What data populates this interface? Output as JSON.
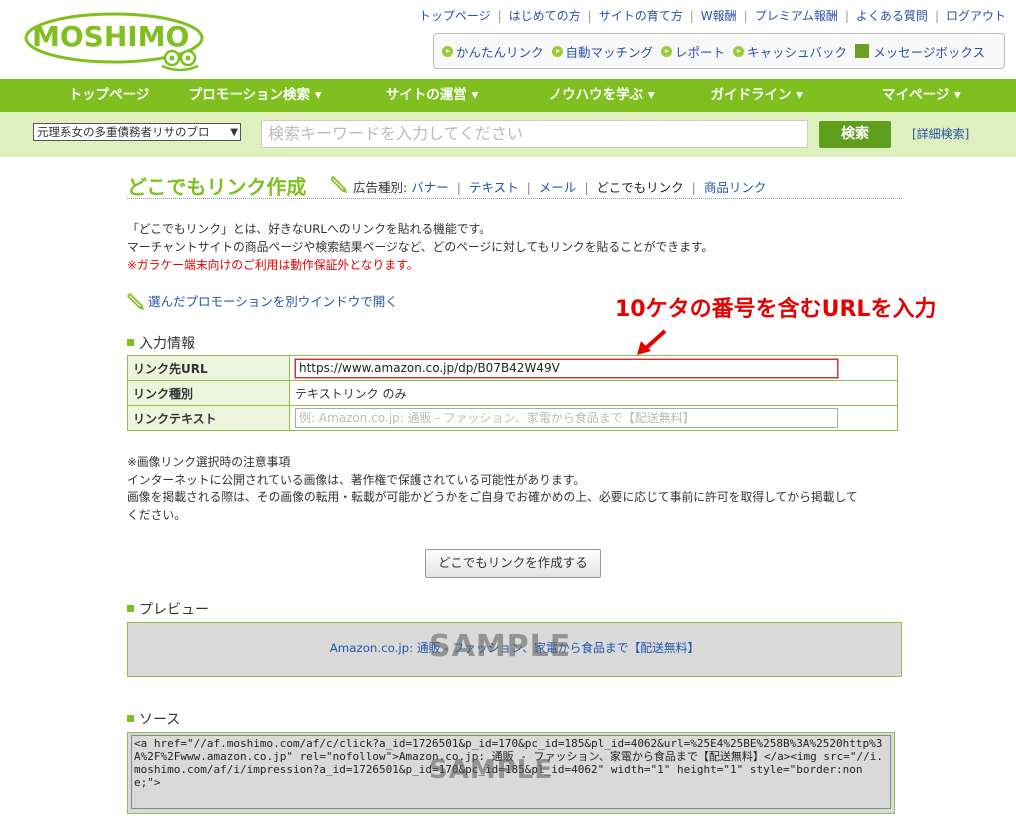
{
  "header": {
    "logo_text": "MOSHIMO",
    "top_links": [
      "トップページ",
      "はじめての方",
      "サイトの育て方",
      "W報酬",
      "プレミアム報酬",
      "よくある質問",
      "ログアウト"
    ],
    "tools": [
      "かんたんリンク",
      "自動マッチング",
      "レポート",
      "キャッシュバック",
      "メッセージボックス"
    ]
  },
  "nav": {
    "items": [
      "トップページ",
      "プロモーション検索 ▾",
      "サイトの運営 ▾",
      "ノウハウを学ぶ ▾",
      "ガイドライン ▾",
      "マイページ ▾"
    ]
  },
  "search": {
    "select_value": "元理系女の多重債務者リサのブロ",
    "placeholder": "検索キーワードを入力してください",
    "button": "検索",
    "advanced": "[詳細検索]"
  },
  "page": {
    "title": "どこでもリンク作成",
    "ad_type_label": "広告種別:",
    "ad_types": [
      "バナー",
      "テキスト",
      "メール",
      "どこでもリンク",
      "商品リンク"
    ],
    "intro": [
      "「どこでもリンク」とは、好きなURLへのリンクを貼れる機能です。",
      "マーチャントサイトの商品ページや検索結果ページなど、どのページに対してもリンクを貼ることができます。"
    ],
    "intro_warning": "※ガラケー端末向けのご利用は動作保証外となります。",
    "open_link": "選んだプロモーションを別ウインドウで開く",
    "annotation": "10ケタの番号を含むURLを入力"
  },
  "input_section": {
    "heading": "入力情報",
    "url_label": "リンク先URL",
    "url_value": "https://www.amazon.co.jp/dp/B07B42W49V",
    "type_label": "リンク種別",
    "type_value": "テキストリンク のみ",
    "text_label": "リンクテキスト",
    "text_placeholder": "例: Amazon.co.jp: 通販 - ファッション、家電から食品まで【配送無料】"
  },
  "notes": {
    "heading": "※画像リンク選択時の注意事項",
    "line1": "インターネットに公開されている画像は、著作権で保護されている可能性があります。",
    "line2": "画像を掲載される際は、その画像の転用・転載が可能かどうかをご自身でお確かめの上、必要に応じて事前に許可を取得してから掲載して",
    "line3": "ください。"
  },
  "create_button": "どこでもリンクを作成する",
  "preview": {
    "heading": "プレビュー",
    "link_text": "Amazon.co.jp: 通販 - ファッション、家電から食品まで【配送無料】",
    "watermark": "SAMPLE"
  },
  "source": {
    "heading": "ソース",
    "code": "<a href=\"//af.moshimo.com/af/c/click?a_id=1726501&p_id=170&pc_id=185&pl_id=4062&url=%25E4%25BE%258B%3A%2520http%3A%2F%2Fwww.amazon.co.jp\" rel=\"nofollow\">Amazon.co.jp: 通販 - ファッション、家電から食品まで【配送無料】</a><img src=\"//i.moshimo.com/af/i/impression?a_id=1726501&p_id=170&pc_id=185&pl_id=4062\" width=\"1\" height=\"1\" style=\"border:none;\">",
    "watermark": "SAMPLE"
  },
  "colors": {
    "brand_green": "#7fbf1f",
    "annotation_red": "#e60000",
    "link_blue": "#2a52a8"
  }
}
